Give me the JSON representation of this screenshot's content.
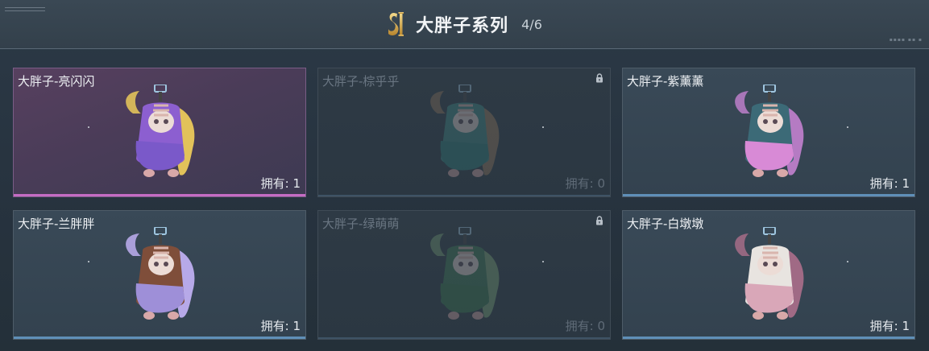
{
  "header": {
    "title": "大胖子系列",
    "count": "4/6"
  },
  "cards": [
    {
      "name": "大胖子-亮闪闪",
      "owned": "拥有: 1",
      "state": "selected",
      "accent": "#8c5fd0",
      "body": "#7a59c9",
      "tail": "#e2c25a"
    },
    {
      "name": "大胖子-棕乎乎",
      "owned": "拥有: 0",
      "state": "locked",
      "accent": "#3e8a86",
      "body": "#2e7f7b",
      "tail": "#9a7a5c"
    },
    {
      "name": "大胖子-紫薰薰",
      "owned": "拥有: 1",
      "state": "normal",
      "accent": "#3c6a77",
      "body": "#d88ad6",
      "tail": "#b57bc3"
    },
    {
      "name": "大胖子-兰胖胖",
      "owned": "拥有: 1",
      "state": "normal",
      "accent": "#7f4e3a",
      "body": "#9e8fd8",
      "tail": "#b7a9e8"
    },
    {
      "name": "大胖子-绿萌萌",
      "owned": "拥有: 0",
      "state": "locked",
      "accent": "#3d7a56",
      "body": "#3a7a4f",
      "tail": "#7ea878"
    },
    {
      "name": "大胖子-白墩墩",
      "owned": "拥有: 1",
      "state": "normal",
      "accent": "#e8e4e0",
      "body": "#d9a7b8",
      "tail": "#a06a85"
    }
  ]
}
